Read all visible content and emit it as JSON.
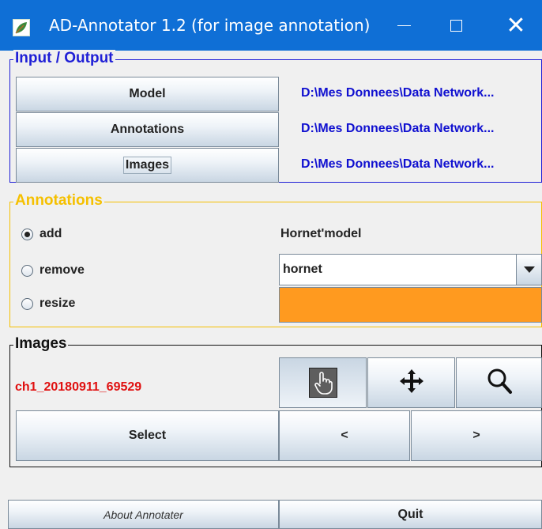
{
  "window": {
    "title": "AD-Annotator 1.2 (for image annotation)",
    "icon": "leaf-app-icon",
    "controls": [
      "minimize-icon",
      "maximize-icon",
      "close-icon"
    ],
    "close_glyph": "✕"
  },
  "io": {
    "legend": "Input / Output",
    "color": "#1f1fd6",
    "rows": [
      {
        "button": "Model",
        "path": "D:\\Mes Donnees\\Data Network..."
      },
      {
        "button": "Annotations",
        "path": "D:\\Mes Donnees\\Data Network..."
      },
      {
        "button": "Images",
        "path": "D:\\Mes Donnees\\Data Network..."
      }
    ]
  },
  "annotations": {
    "legend": "Annotations",
    "color": "#f5c000",
    "modes": [
      {
        "label": "add",
        "selected": true
      },
      {
        "label": "remove",
        "selected": false
      },
      {
        "label": "resize",
        "selected": false
      }
    ],
    "model_label": "Hornet'model",
    "class_select": "hornet",
    "class_color": "#ff9a1f"
  },
  "images": {
    "legend": "Images",
    "current_image": "ch1_20180911_69529",
    "current_image_color": "#e01010",
    "tools": [
      {
        "icon": "hand-pointer-icon",
        "pressed": true
      },
      {
        "icon": "move-arrows-icon",
        "pressed": false
      },
      {
        "icon": "magnifier-icon",
        "pressed": false
      }
    ],
    "select_label": "Select",
    "prev_label": "<",
    "next_label": ">"
  },
  "footer": {
    "about_label": "About Annotater",
    "quit_label": "Quit"
  }
}
